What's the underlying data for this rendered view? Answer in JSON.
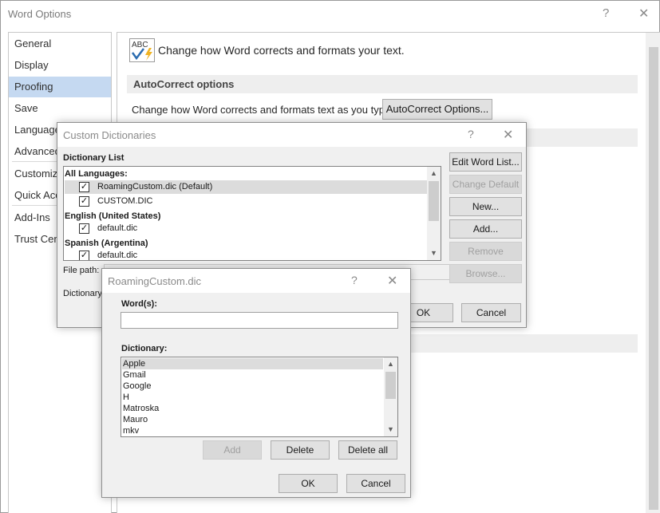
{
  "main_window": {
    "title": "Word Options",
    "help_glyph": "?",
    "close_glyph": "✕",
    "nav": [
      "General",
      "Display",
      "Proofing",
      "Save",
      "Language",
      "Advanced",
      "Customize Ribbon",
      "Quick Access Toolbar",
      "Add-Ins",
      "Trust Center"
    ],
    "active_nav": "Proofing",
    "header_text": "Change how Word corrects and formats your text.",
    "autocorrect_section": "AutoCorrect options",
    "autocorrect_label": "Change how Word corrects and formats text as you type:",
    "autocorrect_button": "AutoCorrect Options..."
  },
  "custom_dictionaries": {
    "title": "Custom Dictionaries",
    "help_glyph": "?",
    "close_glyph": "✕",
    "list_label": "Dictionary List",
    "rows": [
      {
        "type": "group",
        "text": "All Languages:"
      },
      {
        "type": "item",
        "text": "RoamingCustom.dic (Default)",
        "checked": true,
        "selected": true
      },
      {
        "type": "item",
        "text": "CUSTOM.DIC",
        "checked": true
      },
      {
        "type": "group",
        "text": "English (United States)"
      },
      {
        "type": "item",
        "text": "default.dic",
        "checked": true
      },
      {
        "type": "group",
        "text": "Spanish (Argentina)"
      },
      {
        "type": "item",
        "text": "default.dic",
        "checked": true
      }
    ],
    "file_path_label": "File path:",
    "dictionary_language_label": "Dictionary",
    "buttons": {
      "edit_word_list": "Edit Word List...",
      "change_default": "Change Default",
      "new": "New...",
      "add": "Add...",
      "remove": "Remove",
      "browse": "Browse...",
      "ok": "OK",
      "cancel": "Cancel"
    }
  },
  "roaming_dialog": {
    "title": "RoamingCustom.dic",
    "help_glyph": "?",
    "close_glyph": "✕",
    "words_label": "Word(s):",
    "words_value": "",
    "dictionary_label": "Dictionary:",
    "words": [
      "Apple",
      "Gmail",
      "Google",
      "H",
      "Matroska",
      "Mauro",
      "mkv"
    ],
    "selected_word": "Apple",
    "buttons": {
      "add": "Add",
      "delete": "Delete",
      "delete_all": "Delete all",
      "ok": "OK",
      "cancel": "Cancel"
    }
  },
  "scroll_arrows": {
    "up": "▲",
    "down": "▼"
  },
  "check_glyph": "✓"
}
